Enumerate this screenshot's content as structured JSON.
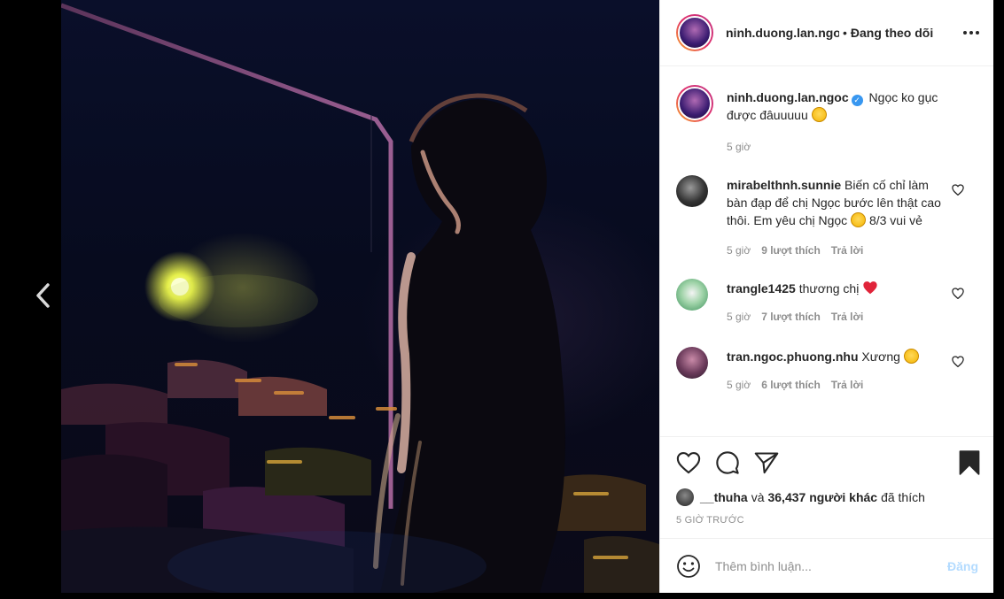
{
  "post": {
    "author": "ninh.duong.lan.ngoc",
    "header_name": "ninh.duong.lan.ngoc",
    "header_separator": "•",
    "follow_status": "Đang theo dõi",
    "caption_user": "ninh.duong.lan.ngoc",
    "caption_text_1": "Ngọc ko gục",
    "caption_text_2": "được đâuuuuu",
    "caption_time": "5 giờ"
  },
  "comments": [
    {
      "user": "mirabelthnh.sunnie",
      "text_1": "Biến cố chỉ làm bàn đạp để chị Ngọc bước lên thật cao thôi. Em yêu chị Ngọc",
      "text_2": "8/3 vui vẻ",
      "time": "5 giờ",
      "likes": "9 lượt thích",
      "reply": "Trả lời"
    },
    {
      "user": "trangle1425",
      "text_1": "thương chị",
      "time": "5 giờ",
      "likes": "7 lượt thích",
      "reply": "Trả lời"
    },
    {
      "user": "tran.ngoc.phuong.nhu",
      "text_1": "Xương",
      "time": "5 giờ",
      "likes": "6 lượt thích",
      "reply": "Trả lời"
    }
  ],
  "likes": {
    "first_user": "__thuha",
    "connector": "và",
    "others": "36,437 người khác",
    "suffix": "đã thích"
  },
  "timestamp": "5 GIỜ TRƯỚC",
  "comment_input": {
    "placeholder": "Thêm bình luận...",
    "post_label": "Đăng"
  },
  "icons": {
    "prev": "chevron-left-icon",
    "more": "more-icon",
    "like": "heart-icon",
    "comment": "comment-icon",
    "share": "share-icon",
    "save": "bookmark-icon",
    "emoji": "emoji-icon"
  },
  "colors": {
    "link_disabled": "#b3dbff",
    "verified": "#3897f0",
    "heart": "#ed4956"
  }
}
